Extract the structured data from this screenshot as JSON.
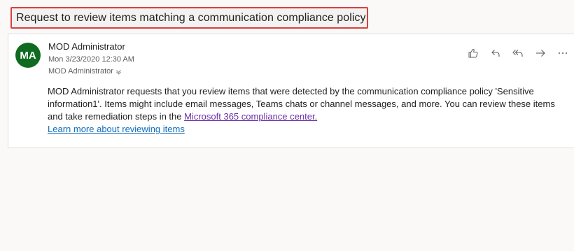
{
  "subject": "Request to review items matching a communication compliance policy",
  "message": {
    "avatar_initials": "MA",
    "avatar_color": "#0f6b1f",
    "sender": "MOD Administrator",
    "date": "Mon 3/23/2020 12:30 AM",
    "recipient": "MOD Administrator",
    "recipient_chevron_icon": "chevron-down-icon",
    "body_text": "MOD Administrator requests that you review items that were detected by the communication compliance policy 'Sensitive information1'. Items might include email messages, Teams chats or channel messages, and more. You can review these items and take remediation steps in the ",
    "body_link": "Microsoft 365 compliance center.",
    "learn_more_link": "Learn more about reviewing items"
  },
  "actions": [
    {
      "name": "like-icon"
    },
    {
      "name": "reply-icon"
    },
    {
      "name": "reply-all-icon"
    },
    {
      "name": "forward-icon"
    },
    {
      "name": "more-icon"
    }
  ],
  "colors": {
    "highlight_frame": "#d9403f",
    "link": "#6b2fa3",
    "learn_link": "#0f6cbd"
  }
}
